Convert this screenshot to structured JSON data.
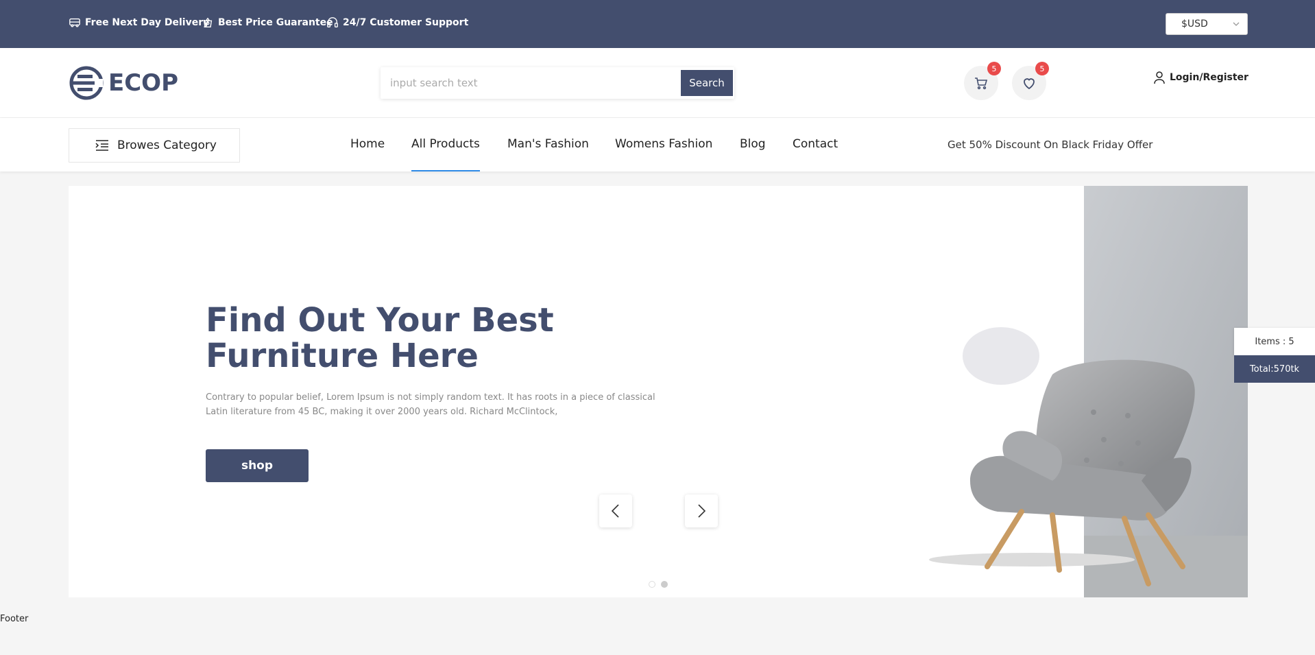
{
  "topbar": {
    "features": [
      {
        "icon": "delivery-truck-icon",
        "label": "Free Next Day Delivery"
      },
      {
        "icon": "price-tag-icon",
        "label": "Best Price Guarantee"
      },
      {
        "icon": "headset-icon",
        "label": "24/7 Customer Support"
      }
    ],
    "currency": "$USD"
  },
  "header": {
    "logo_text": "ECOP",
    "search": {
      "placeholder": "input search text",
      "button_label": "Search"
    },
    "cart_count": "5",
    "wishlist_count": "5",
    "login_label": "Login/Register"
  },
  "nav": {
    "category_label": "Browes Category",
    "items": [
      "Home",
      "All Products",
      "Man's Fashion",
      "Womens Fashion",
      "Blog",
      "Contact"
    ],
    "active_item": "All Products",
    "promo": "Get 50% Discount On Black Friday Offer"
  },
  "hero": {
    "title": "Find Out Your Best Furniture Here",
    "description": "Contrary to popular belief, Lorem Ipsum is not simply random text. It has roots in a piece of classical Latin literature from 45 BC, making it over 2000 years old. Richard McClintock,",
    "button_label": "shop",
    "slides": 2,
    "active_slide": 2
  },
  "side_cart": {
    "items_label": "Items : 5",
    "total_label": "Total:570tk"
  },
  "footer": {
    "label": "Footer"
  },
  "colors": {
    "primary": "#434e6e",
    "badge": "#e94b4b",
    "active_underline": "#2e8ae6"
  }
}
